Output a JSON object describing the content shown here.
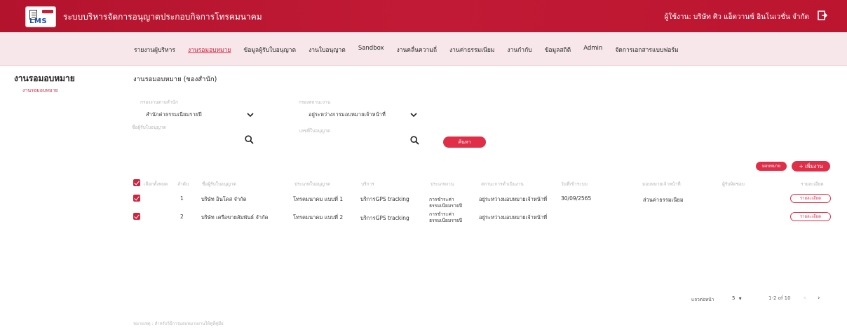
{
  "header": {
    "app_title": "ระบบบริหารจัดการอนุญาตประกอบกิจการโทรคมนาคม",
    "user_info": "ผู้ใช้งาน: บริษัท ศิว แอ็ดวานซ์ อินโนเวชั่น จำกัด",
    "logo_text": "LMS"
  },
  "nav": {
    "items": [
      "รายงานผู้บริหาร",
      "งานรอมอบหมาย",
      "ข้อมูลผู้รับใบอนุญาต",
      "งานใบอนุญาต",
      "Sandbox",
      "งานคลื่นความถี่",
      "งานค่าธรรมเนียม",
      "งานกำกับ",
      "ข้อมูลสถิติ",
      "Admin",
      "จัดการเอกสารแบบฟอร์ม"
    ],
    "active_index": 1
  },
  "sidebar": {
    "title": "งานรอมอบหมาย",
    "link": "งานรอมอบหมาย"
  },
  "main": {
    "title": "งานรอมอบหมาย (ของสำนัก)",
    "filters": {
      "dept_label": "กรองงานตามสำนัก",
      "dept_value": "สำนักค่าธรรมเนียมรายปี",
      "status_label": "กรองสถานะงาน",
      "status_value": "อยู่ระหว่างการมอบหมายเจ้าหน้าที่",
      "licensee_label": "ชื่อผู้รับใบอนุญาต",
      "license_no_label": "เลขที่ใบอนุญาต",
      "search_button": "ค้นหา"
    },
    "actions": {
      "assign_button": "มอบหมาย",
      "add_button": "+ เพิ่มงาน"
    },
    "table": {
      "headers": [
        "เลือกทั้งหมด",
        "ลำดับ",
        "ชื่อผู้รับใบอนุญาต",
        "ประเภทใบอนุญาต",
        "บริการ",
        "ประเภทงาน",
        "สถานะการดำเนินงาน",
        "วันที่เข้าระบบ",
        "มอบหมายเจ้าหน้าที่",
        "ผู้รับผิดชอบ",
        "รายละเอียด"
      ],
      "rows": [
        {
          "index": "1",
          "licensee": "บริษัท อินโดส จำกัด",
          "license_type": "โทรคมนาคม แบบที่ 1",
          "service": "บริการGPS tracking",
          "job_type": "การชำระค่าธรรมเนียมรายปี",
          "status": "อยู่ระหว่างมอบหมายเจ้าหน้าที่",
          "date": "30/09/2565",
          "assigned": "ส่วนค่าธรรมเนียม",
          "detail": "รายละเอียด"
        },
        {
          "index": "2",
          "licensee": "บริษัท เครือขายสัมพันธ์ จำกัด",
          "license_type": "โทรคมนาคม แบบที่ 2",
          "service": "บริการGPS tracking",
          "job_type": "การชำระค่าธรรมเนียมรายปี",
          "status": "อยู่ระหว่างมอบหมายเจ้าหน้าที่",
          "date": "",
          "assigned": "",
          "detail": "รายละเอียด"
        }
      ]
    },
    "pager": {
      "rows_label": "แถวต่อหน้า",
      "page_size": "5",
      "range": "1-2 of 10",
      "prev": "‹",
      "next": "›"
    },
    "footnote": "หมายเหตุ : สำหรับวิธีการมอบหมายงานให้ดูที่คู่มือ"
  },
  "colors": {
    "brand": "#c11a36",
    "accent": "#e02e48",
    "nav_bg": "#f7e7ea"
  }
}
